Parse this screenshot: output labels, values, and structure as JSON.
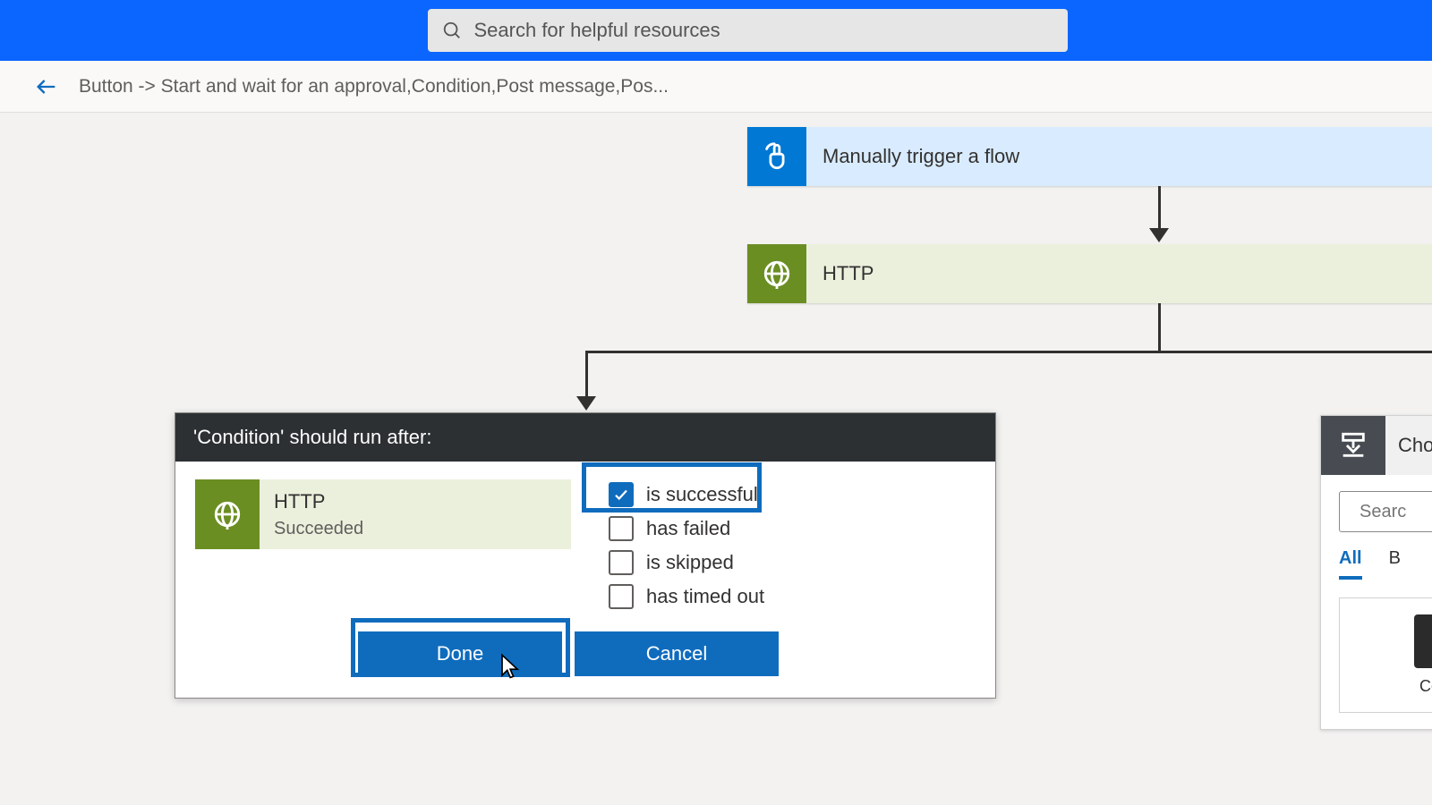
{
  "search": {
    "placeholder": "Search for helpful resources"
  },
  "breadcrumb": {
    "text": "Button -> Start and wait for an approval,Condition,Post message,Pos..."
  },
  "flow": {
    "trigger": {
      "label": "Manually trigger a flow"
    },
    "http": {
      "label": "HTTP"
    }
  },
  "runafter": {
    "title": "'Condition' should run after:",
    "source_name": "HTTP",
    "source_status": "Succeeded",
    "options": [
      {
        "label": "is successful",
        "checked": true
      },
      {
        "label": "has failed",
        "checked": false
      },
      {
        "label": "is skipped",
        "checked": false
      },
      {
        "label": "has timed out",
        "checked": false
      }
    ],
    "done": "Done",
    "cancel": "Cancel"
  },
  "choose": {
    "title": "Cho",
    "search_placeholder": "Searc",
    "tabs": {
      "all": "All",
      "second": "B"
    },
    "connector_label": "Control"
  }
}
